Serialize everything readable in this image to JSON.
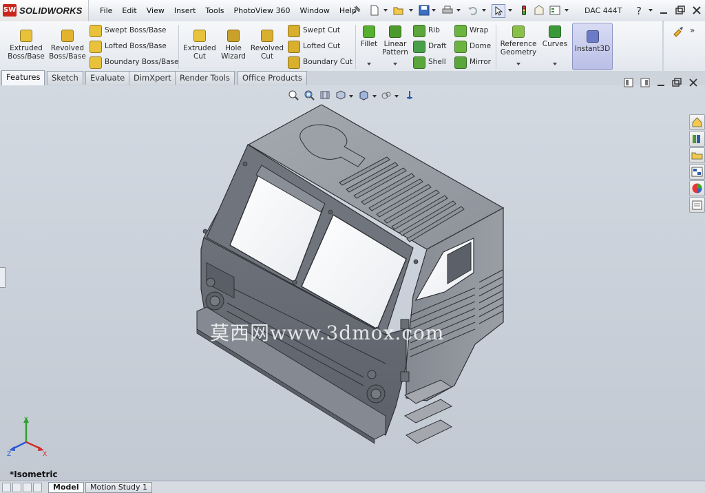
{
  "app": {
    "brand_mark": "SW",
    "brand_name": "SOLIDWORKS",
    "document": "DAC 444T"
  },
  "menu": [
    "File",
    "Edit",
    "View",
    "Insert",
    "Tools",
    "PhotoView 360",
    "Window",
    "Help"
  ],
  "toolbar_icons": [
    "new-document-icon",
    "open-icon",
    "save-icon",
    "print-icon",
    "undo-icon",
    "select-icon",
    "rebuild-icon",
    "file-properties-icon",
    "options-icon",
    "help-icon"
  ],
  "command_manager": {
    "large_buttons": [
      {
        "line1": "Extruded",
        "line2": "Boss/Base",
        "color": "#e8c23a"
      },
      {
        "line1": "Revolved",
        "line2": "Boss/Base",
        "color": "#e2b32f"
      },
      {
        "line1": "Extruded",
        "line2": "Cut",
        "color": "#e8c23a"
      },
      {
        "line1": "Hole",
        "line2": "Wizard",
        "color": "#c9a02a"
      },
      {
        "line1": "Revolved",
        "line2": "Cut",
        "color": "#d9b02e"
      },
      {
        "line1": "Fillet",
        "line2": "",
        "color": "#58b030"
      },
      {
        "line1": "Linear",
        "line2": "Pattern",
        "color": "#4c9a2c"
      },
      {
        "line1": "Reference",
        "line2": "Geometry",
        "color": "#8ac048"
      },
      {
        "line1": "Curves",
        "line2": "",
        "color": "#3a9a3a"
      },
      {
        "line1": "Instant3D",
        "line2": "",
        "color": "#6c7bc8"
      }
    ],
    "small_buttons": [
      {
        "label": "Swept Boss/Base",
        "color": "#e8c23a"
      },
      {
        "label": "Lofted Boss/Base",
        "color": "#e8c23a"
      },
      {
        "label": "Boundary Boss/Base",
        "color": "#e8c23a"
      },
      {
        "label": "Swept Cut",
        "color": "#d9b02e"
      },
      {
        "label": "Lofted Cut",
        "color": "#d9b02e"
      },
      {
        "label": "Boundary Cut",
        "color": "#d9b02e"
      },
      {
        "label": "Rib",
        "color": "#5aa63a"
      },
      {
        "label": "Draft",
        "color": "#4aa04a"
      },
      {
        "label": "Shell",
        "color": "#5aa63a"
      },
      {
        "label": "Wrap",
        "color": "#6ab440"
      },
      {
        "label": "Dome",
        "color": "#6ab440"
      },
      {
        "label": "Mirror",
        "color": "#5aa63a"
      }
    ]
  },
  "tabs": [
    {
      "label": "Features",
      "active": true
    },
    {
      "label": "Sketch",
      "active": false
    },
    {
      "label": "Evaluate",
      "active": false
    },
    {
      "label": "DimXpert",
      "active": false
    },
    {
      "label": "Render Tools",
      "active": false
    },
    {
      "label": "Office Products",
      "active": false
    }
  ],
  "viewport": {
    "view_name": "*Isometric",
    "watermark": "莫西网www.3dmox.com",
    "axes": {
      "x": "X",
      "y": "Y",
      "z": "Z"
    }
  },
  "bottom_tabs": [
    {
      "label": "Model",
      "active": true
    },
    {
      "label": "Motion Study 1",
      "active": false
    }
  ]
}
